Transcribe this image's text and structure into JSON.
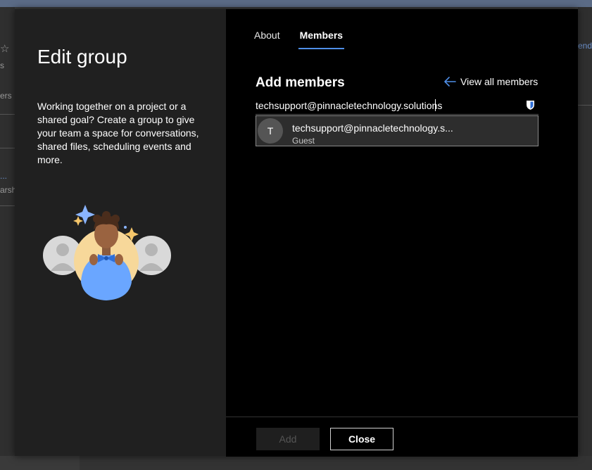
{
  "background": {
    "left_fragments": [
      "s",
      "ers",
      "...",
      "arsh"
    ],
    "right_fragment": "end"
  },
  "dialog": {
    "title": "Edit group",
    "description": "Working together on a project or a shared goal? Create a group to give your team a space for conversations, shared files, scheduling events and more.",
    "tabs": [
      {
        "label": "About",
        "active": false
      },
      {
        "label": "Members",
        "active": true
      }
    ],
    "add_members": {
      "heading": "Add members",
      "view_all_label": "View all members",
      "search_value": "techsupport@pinnacletechnology.solutions",
      "suggestion": {
        "initial": "T",
        "email": "techsupport@pinnacletechnology.s...",
        "role": "Guest"
      }
    },
    "footer": {
      "add_label": "Add",
      "close_label": "Close"
    }
  },
  "colors": {
    "accent": "#4f8fe8",
    "dialog_bg": "#000000",
    "left_pane_bg": "#202020",
    "suggestion_bg": "#2d2d2d"
  },
  "icons": [
    "arrow-left-icon",
    "shield-icon",
    "star-icon"
  ]
}
